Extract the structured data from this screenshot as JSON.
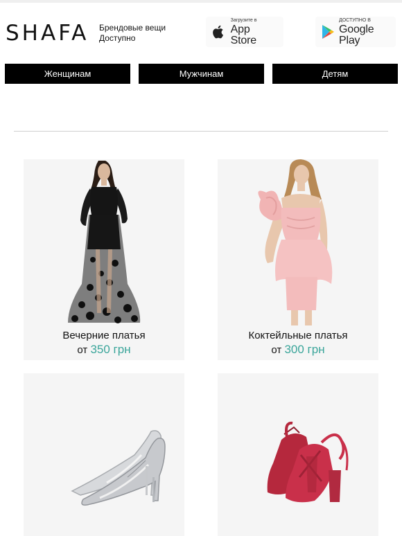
{
  "header": {
    "logo": "SHAFA",
    "tagline_line1": "Брендовые вещи",
    "tagline_line2": "Доступно",
    "app_store": {
      "small": "Загрузите в",
      "big": "App Store",
      "icon": "apple-icon"
    },
    "google_play": {
      "small": "ДОСТУПНО В",
      "big": "Google Play",
      "icon": "google-play-icon"
    }
  },
  "nav": {
    "items": [
      {
        "label": "Женщинам"
      },
      {
        "label": "Мужчинам"
      },
      {
        "label": "Детям"
      }
    ]
  },
  "products": [
    {
      "title": "Вечерние платья",
      "price_prefix": "от",
      "price": "350 грн",
      "image": "black lace evening gown"
    },
    {
      "title": "Коктейльные платья",
      "price_prefix": "от",
      "price": "300 грн",
      "image": "pink cocktail dress with ruffle"
    },
    {
      "title": "",
      "price_prefix": "",
      "price": "",
      "image": "silver transparent stiletto pumps"
    },
    {
      "title": "",
      "price_prefix": "",
      "price": "",
      "image": "red suede block heel sandals"
    }
  ],
  "colors": {
    "accent_price": "#3aa59a",
    "nav_bg": "#000000",
    "card_bg": "#f5f5f5"
  }
}
